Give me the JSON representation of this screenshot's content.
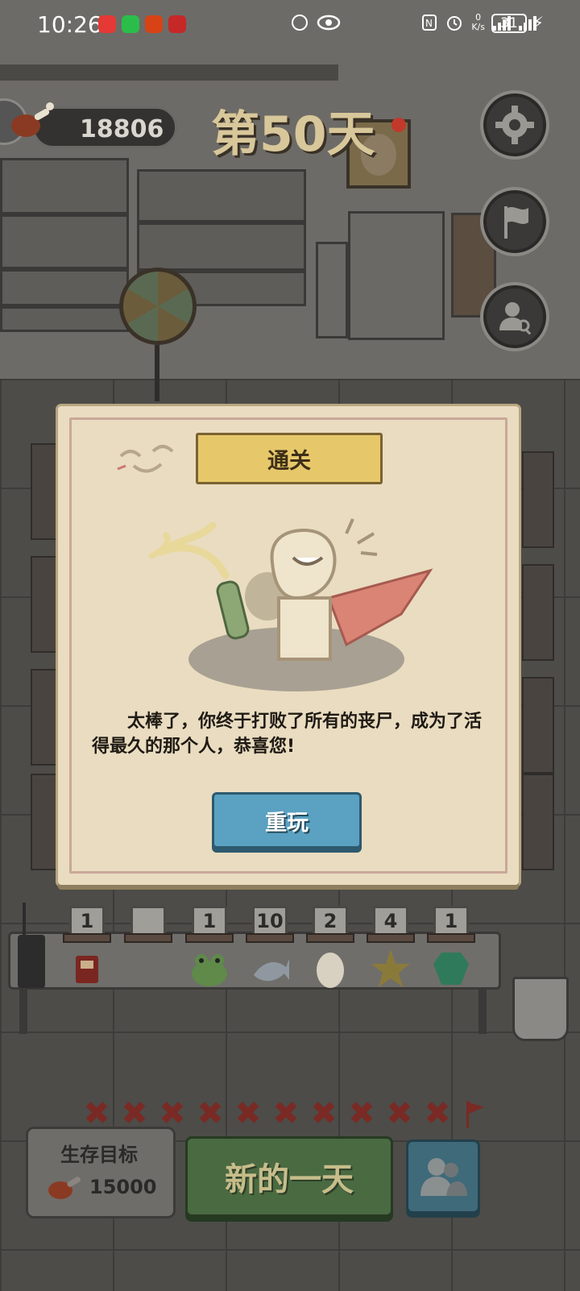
{
  "status_bar": {
    "time": "10:26",
    "network_speed": "0\nK/s",
    "battery": "31"
  },
  "hud": {
    "meat_count": "18806",
    "day_title": "第50天",
    "icons": [
      "settings-gear-icon",
      "flag-icon",
      "person-search-icon",
      "chat-icon"
    ]
  },
  "dialog": {
    "title": "通关",
    "message": "太棒了，你终于打败了所有的丧尸，成为了活得最久的那个人，恭喜您!",
    "replay_button": "重玩"
  },
  "items": [
    {
      "count": "1",
      "icon": "walkie-talkie-box-icon"
    },
    {
      "count": "",
      "icon": "empty-slot"
    },
    {
      "count": "1",
      "icon": "frog-icon"
    },
    {
      "count": "10",
      "icon": "fish-icon"
    },
    {
      "count": "2",
      "icon": "egg-icon"
    },
    {
      "count": "4",
      "icon": "star-icon"
    },
    {
      "count": "1",
      "icon": "emerald-icon"
    }
  ],
  "progress": {
    "marks": [
      "✖",
      "✖",
      "✖",
      "✖",
      "✖",
      "✖",
      "✖",
      "✖",
      "✖",
      "✖"
    ]
  },
  "bottom": {
    "goal_label": "生存目标",
    "goal_value": "15000",
    "new_day_button": "新的一天"
  },
  "colors": {
    "dialog_bg": "#e9dcc0",
    "banner": "#e6c86a",
    "replay_button": "#5aa1c2",
    "new_day_button": "#4a6a42",
    "day_title": "#d8c79a"
  }
}
